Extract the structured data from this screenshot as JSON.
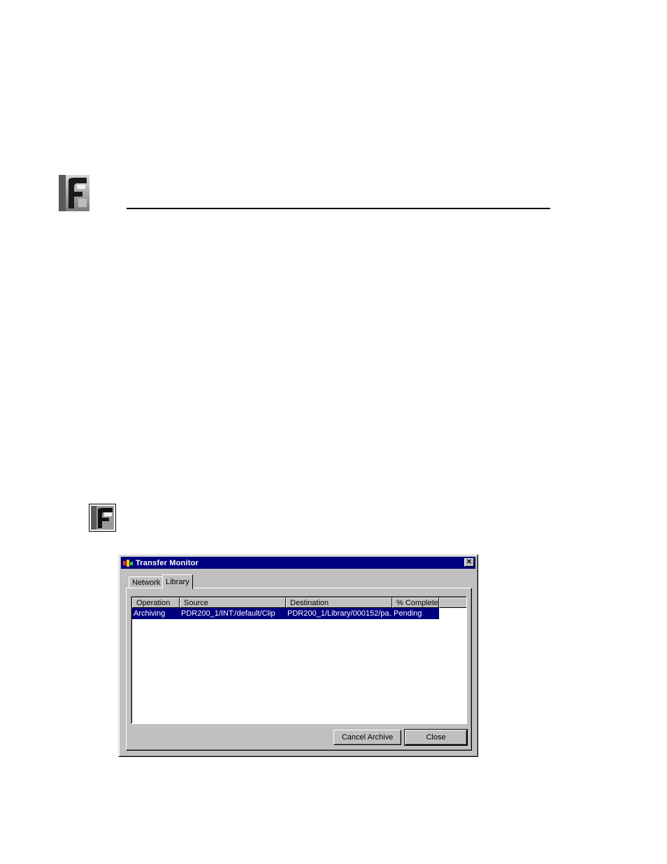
{
  "window": {
    "title": "Transfer Monitor",
    "close_glyph": "✕"
  },
  "tabs": [
    {
      "label": "Network",
      "active": false
    },
    {
      "label": "Library",
      "active": true
    }
  ],
  "list": {
    "columns": [
      "Operation",
      "Source",
      "Destination",
      "% Complete"
    ],
    "rows": [
      {
        "operation": "Archiving",
        "source": "PDR200_1/INT:/default/Clip",
        "destination": "PDR200_1/Library/000152/pa...",
        "complete": "Pending",
        "selected": true
      }
    ]
  },
  "buttons": {
    "cancel_archive": "Cancel Archive",
    "close": "Close"
  },
  "colors": {
    "titlebar": "#000080",
    "selection": "#000080",
    "face": "#c0c0c0"
  },
  "icons": {
    "page_logo": "profile-logo-icon",
    "note": "profile-note-icon",
    "app": "transfer-monitor-app-icon"
  }
}
